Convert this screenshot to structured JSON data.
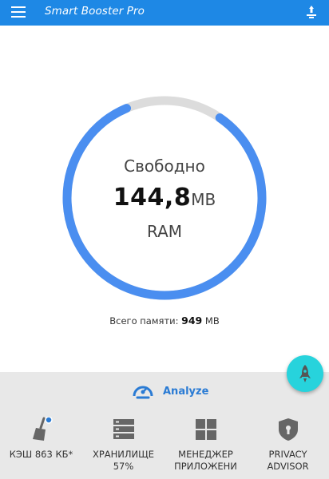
{
  "appbar": {
    "title": "Smart Booster Pro",
    "menu_icon": "hamburger-menu-icon",
    "action_icon": "boost-download-icon"
  },
  "memory": {
    "free_label": "Свободно",
    "free_value": "144,8",
    "free_unit": "MB",
    "ram_label": "RAM",
    "total_prefix": "Всего памяти:",
    "total_value": "949",
    "total_unit": "MB",
    "free_fraction": 0.84
  },
  "analyze": {
    "label": "Analyze",
    "icon": "speedometer-icon"
  },
  "tools": [
    {
      "label": "КЭШ 863 КБ*",
      "icon": "broom-icon",
      "badge": true
    },
    {
      "label": "ХРАНИЛИЩЕ\n57%",
      "line1": "ХРАНИЛИЩЕ",
      "line2": "57%",
      "icon": "storage-icon"
    },
    {
      "line1": "МЕНЕДЖЕР",
      "line2": "ПРИЛОЖЕНИ",
      "icon": "app-grid-icon"
    },
    {
      "line1": "PRIVACY",
      "line2": "ADVISOR",
      "icon": "shield-lock-icon"
    }
  ],
  "colors": {
    "primary": "#1e88e5",
    "gauge_fill": "#4a8ef0",
    "gauge_track": "#dcdcdc",
    "fab": "#27d3dc",
    "accent_text": "#2a7bd4"
  }
}
